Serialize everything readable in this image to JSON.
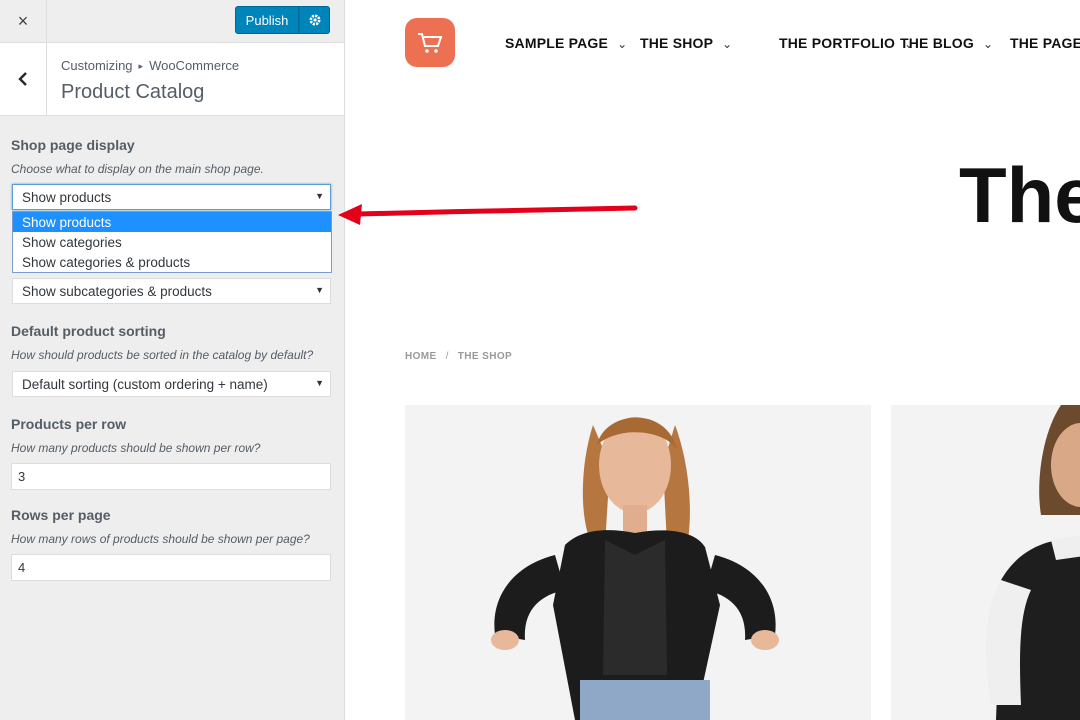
{
  "customizer": {
    "close_icon": "×",
    "publish_label": "Publish",
    "gear_icon": "⚙",
    "back_icon": "‹",
    "breadcrumb": [
      "Customizing",
      "WooCommerce"
    ],
    "breadcrumb_sep": "▸",
    "section_title": "Product Catalog",
    "accent_color": "#0085ba"
  },
  "controls": {
    "shop_display": {
      "title": "Shop page display",
      "description": "Choose what to display on the main shop page.",
      "value": "Show products",
      "options": [
        "Show products",
        "Show categories",
        "Show categories & products"
      ]
    },
    "category_display": {
      "value": "Show subcategories & products"
    },
    "sorting": {
      "title": "Default product sorting",
      "description": "How should products be sorted in the catalog by default?",
      "value": "Default sorting (custom ordering + name)"
    },
    "per_row": {
      "title": "Products per row",
      "description": "How many products should be shown per row?",
      "value": "3"
    },
    "rows_per_page": {
      "title": "Rows per page",
      "description": "How many rows of products should be shown per page?",
      "value": "4"
    }
  },
  "preview": {
    "logo_icon": "cart-icon",
    "brand_color": "#ee7053",
    "nav": [
      "SAMPLE PAGE",
      "THE SHOP",
      "THE PORTFOLIO",
      "THE BLOG",
      "THE PAGE B"
    ],
    "chevron": "⌄",
    "hero_title": "The",
    "breadcrumb": [
      "HOME",
      "THE SHOP"
    ],
    "breadcrumb_sep": "/"
  }
}
